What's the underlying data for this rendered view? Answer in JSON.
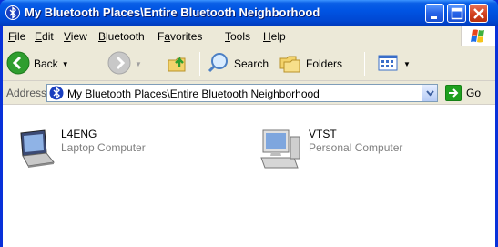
{
  "window": {
    "title": "My Bluetooth Places\\Entire Bluetooth Neighborhood",
    "icon": "bluetooth-places-icon"
  },
  "menubar": {
    "items": [
      {
        "label": "File",
        "underline": "F",
        "rest": "ile"
      },
      {
        "label": "Edit",
        "underline": "E",
        "rest": "dit"
      },
      {
        "label": "View",
        "underline": "V",
        "rest": "iew"
      },
      {
        "label": "Bluetooth",
        "underline": "B",
        "rest": "luetooth"
      },
      {
        "label": "Favorites",
        "underline": "a",
        "prefix": "F",
        "rest": "vorites"
      },
      {
        "label": "Tools",
        "underline": "T",
        "rest": "ools"
      },
      {
        "label": "Help",
        "underline": "H",
        "rest": "elp"
      }
    ]
  },
  "toolbar": {
    "back_label": "Back",
    "search_label": "Search",
    "folders_label": "Folders"
  },
  "addressbar": {
    "label": "Address",
    "value": "My Bluetooth Places\\Entire Bluetooth Neighborhood",
    "go_label": "Go"
  },
  "content": {
    "devices": [
      {
        "name": "L4ENG",
        "type": "Laptop Computer",
        "icon": "laptop-icon"
      },
      {
        "name": "VTST",
        "type": "Personal Computer",
        "icon": "desktop-computer-icon"
      }
    ]
  },
  "colors": {
    "titlebar": "#0054e3",
    "chrome": "#ece9d8",
    "close_button": "#d2401e",
    "go_button": "#1fa01f"
  }
}
